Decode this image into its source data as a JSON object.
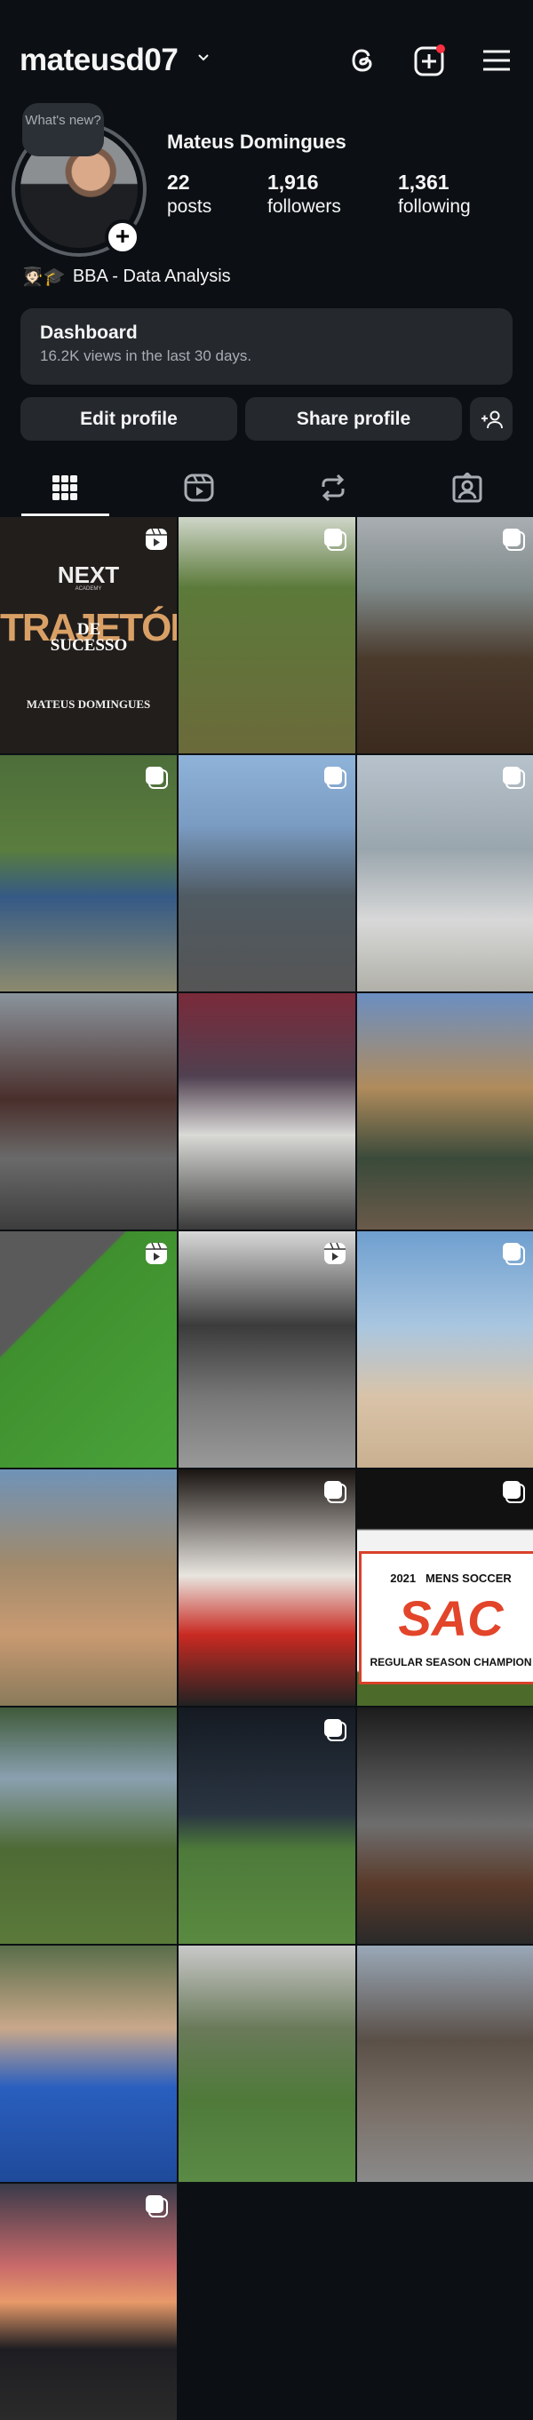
{
  "header": {
    "username": "mateusd07",
    "icons": [
      "chevron-down-icon",
      "threads-icon",
      "create-icon",
      "menu-icon"
    ],
    "notification_color": "#ff3040"
  },
  "profile": {
    "bubble": "What's new?",
    "name": "Mateus Domingues",
    "bio_emoji": "🧑🏻‍🎓🎓",
    "bio": "BBA - Data Analysis",
    "stats": [
      {
        "value": "22",
        "label": "posts"
      },
      {
        "value": "1,916",
        "label": "followers"
      },
      {
        "value": "1,361",
        "label": "following"
      }
    ]
  },
  "dashboard": {
    "title": "Dashboard",
    "subtitle": "16.2K views in the last 30 days."
  },
  "buttons": {
    "edit": "Edit profile",
    "share": "Share profile"
  },
  "tabs": [
    "grid-icon",
    "reels-icon",
    "reposts-icon",
    "tagged-icon"
  ],
  "post1": {
    "brand": "NEXT",
    "brand_sub": "ACADEMY",
    "title": "TRAJETÓRIA",
    "overlay": "DE SUCESSO",
    "name": "MATEUS DOMINGUES"
  },
  "post_banner": {
    "line1": "2021   MENS SOCCER",
    "big": "SAC",
    "line2": "REGULAR SEASON CHAMPION"
  },
  "posts": [
    {
      "type": "reel",
      "bg": "#221e1c"
    },
    {
      "type": "carousel",
      "bg": "linear-gradient(#cfd6c9,#5c7a3a 30%,#6b6a3a)"
    },
    {
      "type": "carousel",
      "bg": "linear-gradient(#a9aeb2,#7f8a8a 30%,#4a3a2c 60%,#3b2a1e)"
    },
    {
      "type": "carousel",
      "bg": "linear-gradient(#4d6e3a,#5a7d3e 40%,#355a86 60%,#8c8a6e)"
    },
    {
      "type": "carousel",
      "bg": "linear-gradient(#8fb3d9,#7a9bc2 30%,#4f5a62 60%,#555)"
    },
    {
      "type": "carousel",
      "bg": "linear-gradient(#b7c2cc,#9aa6ad 40%,#d8d8d8 70%,#b0b0a8)"
    },
    {
      "type": "none",
      "bg": "linear-gradient(#8a949c,#4a2f2c 45%,#6a6a6a 70%,#3d3d3d)"
    },
    {
      "type": "none",
      "bg": "linear-gradient(#7a2a3a,#504050 35%,#d9d9d6 60%,#3a3a3a)"
    },
    {
      "type": "none",
      "bg": "linear-gradient(#6b8fc2,#b08b5c 40%,#3a4a3a 70%,#6a5a4a)"
    },
    {
      "type": "reel",
      "bg": "linear-gradient(135deg,#5a5a5a 0 30%,#3f8f2e 31%,#4aa33a)"
    },
    {
      "type": "reel",
      "bg": "linear-gradient(#d8d8d8,#3b3b3b 40%,#777 70%,#999)"
    },
    {
      "type": "carousel",
      "bg": "linear-gradient(#6f9fcf,#a9c6e0 40%,#d9c3a8 70%,#c9b090)"
    },
    {
      "type": "none",
      "bg": "linear-gradient(#6f93b8,#a08a6c 40%,#c99a72 70%,#8a7a5a)"
    },
    {
      "type": "carousel",
      "bg": "linear-gradient(#1a1512,#e8e4de 45%,#c92a22 70%,#222)"
    },
    {
      "type": "carousel",
      "bg": "linear-gradient(#111 0 25%,#f2f2f2 26% 85%,#4c6a2a 86%)"
    },
    {
      "type": "none",
      "bg": "linear-gradient(#3f5a3a,#8aa0b0 30%,#4e6a35 60%,#5a7a3a)"
    },
    {
      "type": "carousel",
      "bg": "linear-gradient(#151a22,#2a3542 45%,#4d7a3a 60%,#5a8a40)"
    },
    {
      "type": "none",
      "bg": "linear-gradient(#1c1c1c,#6e6e6e 50%,#5a3a2a 75%,#2a2a2a)"
    },
    {
      "type": "none",
      "bg": "linear-gradient(#5a6e4a,#c9a88a 35%,#2a5fbf 60%,#1f4a9a)"
    },
    {
      "type": "none",
      "bg": "linear-gradient(#c9c9c9,#6a7a5a 35%,#4f7a3a 65%,#5a8a45)"
    },
    {
      "type": "none",
      "bg": "linear-gradient(#9aa8b8,#5a5048 40%,#7a7068 70%,#8a8a8a)"
    },
    {
      "type": "carousel",
      "bg": "linear-gradient(#3a3a4a,#c96a6a 35%,#e89a6a 50%,#1e1e22 70%,#2a2a2a)"
    }
  ]
}
